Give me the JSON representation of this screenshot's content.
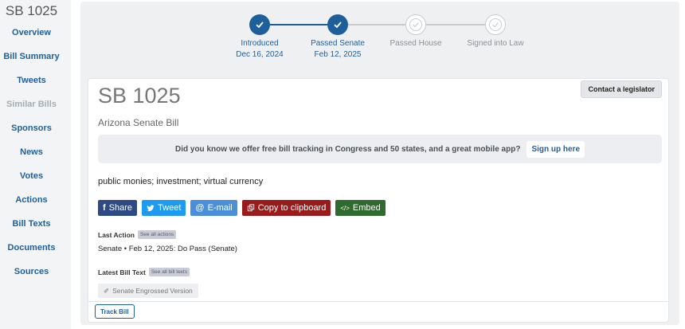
{
  "sidebar": {
    "bill_id": "SB 1025",
    "items": [
      {
        "label": "Overview",
        "enabled": true
      },
      {
        "label": "Bill Summary",
        "enabled": true
      },
      {
        "label": "Tweets",
        "enabled": true
      },
      {
        "label": "Similar Bills",
        "enabled": false
      },
      {
        "label": "Sponsors",
        "enabled": true
      },
      {
        "label": "News",
        "enabled": true
      },
      {
        "label": "Votes",
        "enabled": true
      },
      {
        "label": "Actions",
        "enabled": true
      },
      {
        "label": "Bill Texts",
        "enabled": true
      },
      {
        "label": "Documents",
        "enabled": true
      },
      {
        "label": "Sources",
        "enabled": true
      }
    ]
  },
  "progress": {
    "steps": [
      {
        "label": "Introduced",
        "date": "Dec 16, 2024",
        "done": true
      },
      {
        "label": "Passed Senate",
        "date": "Feb 12, 2025",
        "done": true
      },
      {
        "label": "Passed House",
        "date": "",
        "done": false
      },
      {
        "label": "Signed into Law",
        "date": "",
        "done": false
      }
    ]
  },
  "card": {
    "contact_label": "Contact a legislator",
    "title": "SB 1025",
    "subtitle": "Arizona Senate Bill",
    "promo_text": "Did you know we offer free bill tracking in Congress and 50 states, and a great mobile app?",
    "promo_link": "Sign up here",
    "topics": "public monies; investment; virtual currency",
    "share": {
      "share": "Share",
      "tweet": "Tweet",
      "email": "E-mail",
      "copy": "Copy to clipboard",
      "embed": "Embed"
    },
    "last_action_label": "Last Action",
    "last_action_pill": "See all actions",
    "last_action_text": "Senate • Feb 12, 2025: Do Pass (Senate)",
    "latest_text_label": "Latest Bill Text",
    "latest_text_pill": "See all bill texts",
    "latest_text_link": "Senate Engrossed Version",
    "track_label": "Track Bill"
  },
  "colors": {
    "accent": "#1e5f9b",
    "share_facebook": "#2d4a86",
    "share_twitter": "#1d9bf0",
    "share_email": "#4a90d9",
    "share_copy": "#9a1b1b",
    "share_embed": "#2f6b2f"
  }
}
